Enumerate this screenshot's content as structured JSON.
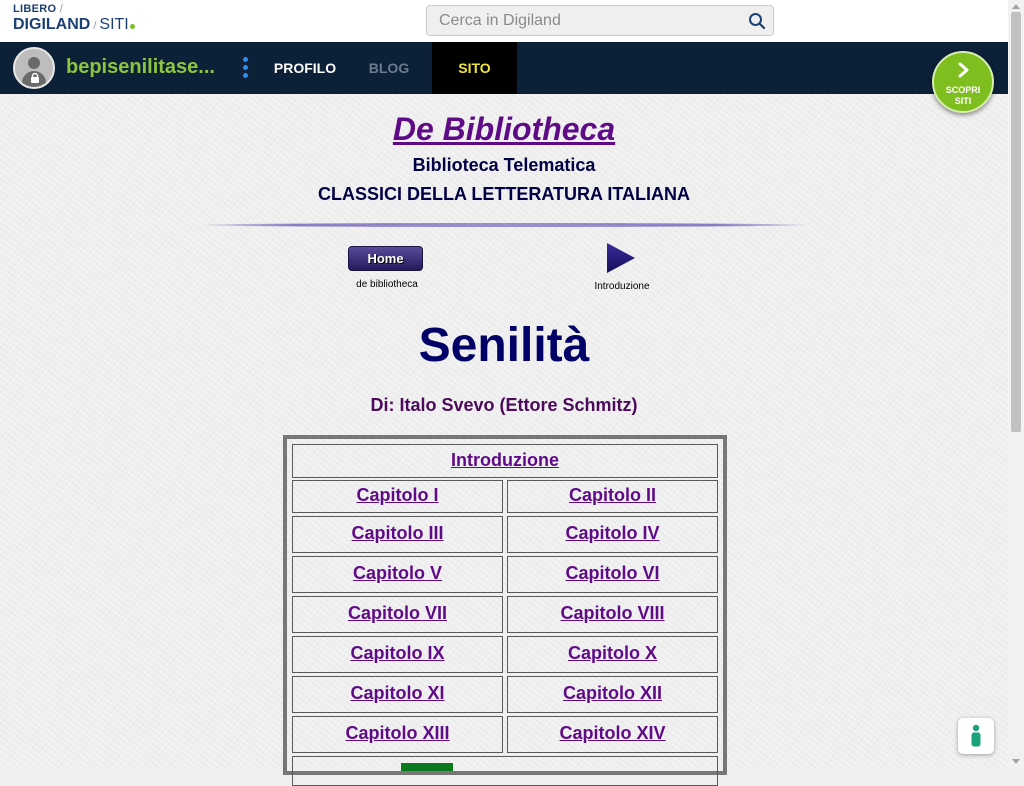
{
  "header": {
    "logo": {
      "top": "LIBERO",
      "slash": "/",
      "brand": "DIGILAND",
      "sep": "/",
      "section": "SITI"
    },
    "search": {
      "placeholder": "Cerca in Digiland"
    }
  },
  "navbar": {
    "site_name": "bepisenilitase...",
    "tabs": [
      {
        "label": "PROFILO"
      },
      {
        "label": "BLOG"
      },
      {
        "label": "SITO"
      }
    ],
    "discover_button": {
      "line1": "SCOPRI",
      "line2": "SITI"
    }
  },
  "page": {
    "site_title": "De Bibliotheca",
    "subtitle": "Biblioteca Telematica",
    "subtitle2": "CLASSICI DELLA LETTERATURA ITALIANA",
    "home_button": "Home",
    "home_caption": "de bibliotheca",
    "next_caption": "Introduzione",
    "book_title": "Senilità",
    "author": "Di: Italo Svevo (Ettore Schmitz)",
    "toc": {
      "intro": "Introduzione",
      "chapters": [
        "Capitolo I",
        "Capitolo II",
        "Capitolo III",
        "Capitolo IV",
        "Capitolo V",
        "Capitolo VI",
        "Capitolo VII",
        "Capitolo VIII",
        "Capitolo IX",
        "Capitolo X",
        "Capitolo XI",
        "Capitolo XII",
        "Capitolo XIII",
        "Capitolo XIV"
      ]
    }
  },
  "colors": {
    "navbar": "#0c2038",
    "site_name": "#8cc63e",
    "active_tab": "#f2e33b",
    "link": "#5f0a87",
    "heading": "#000066"
  }
}
